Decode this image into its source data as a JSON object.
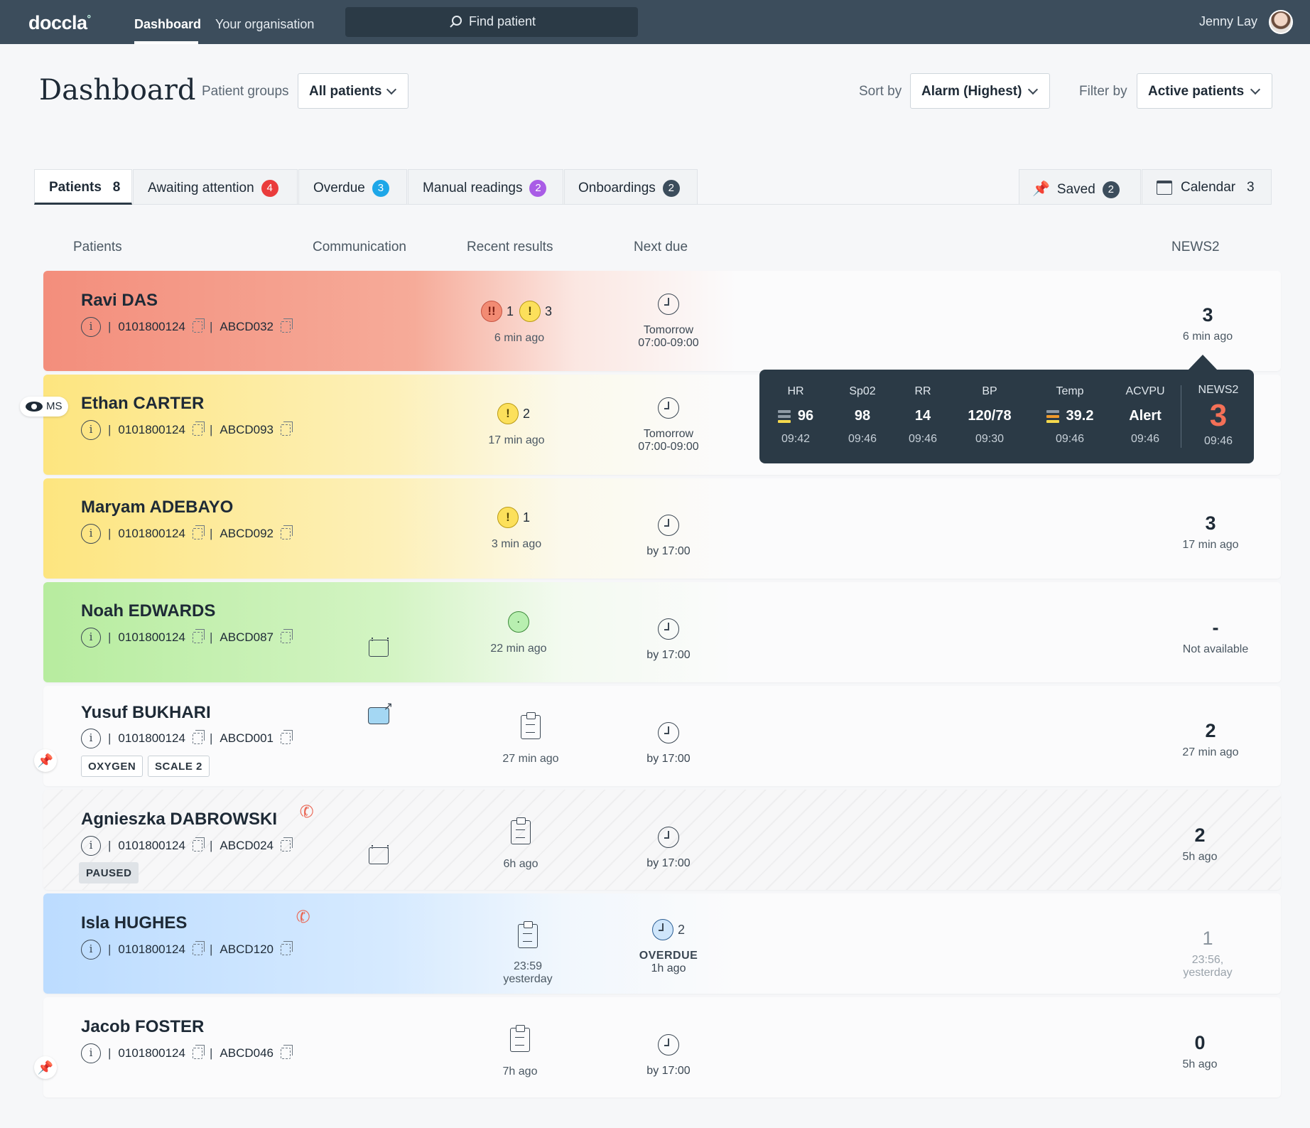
{
  "nav": {
    "logo": "doccla",
    "links": [
      "Dashboard",
      "Your organisation"
    ],
    "search_placeholder": "Find patient",
    "user": "Jenny Lay"
  },
  "header": {
    "title": "Dashboard",
    "patient_groups_label": "Patient groups",
    "patient_groups_value": "All patients",
    "sort_label": "Sort by",
    "sort_value": "Alarm (Highest)",
    "filter_label": "Filter by",
    "filter_value": "Active patients"
  },
  "tabs": [
    {
      "label": "Patients",
      "count": "8"
    },
    {
      "label": "Awaiting attention",
      "count": "4"
    },
    {
      "label": "Overdue",
      "count": "3"
    },
    {
      "label": "Manual readings",
      "count": "2"
    },
    {
      "label": "Onboardings",
      "count": "2"
    },
    {
      "label": "Saved",
      "count": "2"
    },
    {
      "label": "Calendar",
      "count": "3"
    }
  ],
  "columns": [
    "Patients",
    "Communication",
    "Recent results",
    "Next due",
    "NEWS2"
  ],
  "watch_badge": "MS",
  "patients": [
    {
      "name": "Ravi DAS",
      "nhs": "0101800124",
      "code": "ABCD032",
      "alerts": [
        "1",
        "3"
      ],
      "result_time": "6 min ago",
      "due_line1": "Tomorrow",
      "due_line2": "07:00-09:00",
      "news": "3",
      "news_time": "6 min ago"
    },
    {
      "name": "Ethan CARTER",
      "nhs": "0101800124",
      "code": "ABCD093",
      "alerts": [
        "2"
      ],
      "result_time": "17 min ago",
      "due_line1": "Tomorrow",
      "due_line2": "07:00-09:00"
    },
    {
      "name": "Maryam ADEBAYO",
      "nhs": "0101800124",
      "code": "ABCD092",
      "alerts": [
        "1"
      ],
      "result_time": "3 min ago",
      "due_line1": "by 17:00",
      "news": "3",
      "news_time": "17 min ago"
    },
    {
      "name": "Noah EDWARDS",
      "nhs": "0101800124",
      "code": "ABCD087",
      "result_time": "22 min ago",
      "due_line1": "by 17:00",
      "news": "-",
      "news_time": "Not available"
    },
    {
      "name": "Yusuf BUKHARI",
      "nhs": "0101800124",
      "code": "ABCD001",
      "tags": [
        "OXYGEN",
        "SCALE 2"
      ],
      "result_time": "27 min ago",
      "due_line1": "by 17:00",
      "news": "2",
      "news_time": "27 min ago"
    },
    {
      "name": "Agnieszka DABROWSKI",
      "nhs": "0101800124",
      "code": "ABCD024",
      "tags": [
        "PAUSED"
      ],
      "result_time": "6h ago",
      "due_line1": "by 17:00",
      "news": "2",
      "news_time": "5h ago"
    },
    {
      "name": "Isla HUGHES",
      "nhs": "0101800124",
      "code": "ABCD120",
      "result_time_line1": "23:59",
      "result_time_line2": "yesterday",
      "due_count": "2",
      "due_line1": "OVERDUE",
      "due_line2": "1h ago",
      "news": "1",
      "news_time_line1": "23:56,",
      "news_time_line2": "yesterday"
    },
    {
      "name": "Jacob FOSTER",
      "nhs": "0101800124",
      "code": "ABCD046",
      "result_time": "7h ago",
      "due_line1": "by 17:00",
      "news": "0",
      "news_time": "5h ago"
    }
  ],
  "vitals_popup": {
    "items": [
      {
        "label": "HR",
        "value": "96",
        "time": "09:42"
      },
      {
        "label": "Sp02",
        "value": "98",
        "time": "09:46"
      },
      {
        "label": "RR",
        "value": "14",
        "time": "09:46"
      },
      {
        "label": "BP",
        "value": "120/78",
        "time": "09:30"
      },
      {
        "label": "Temp",
        "value": "39.2",
        "time": "09:46"
      },
      {
        "label": "ACVPU",
        "value": "Alert",
        "time": "09:46"
      }
    ],
    "news_label": "NEWS2",
    "news_value": "3",
    "news_time": "09:46"
  },
  "colors": {
    "nav": "#3c4d5c",
    "alarm": "#f38e7c",
    "warn": "#fde57f",
    "ok": "#b7ec9f",
    "info": "#bcdcff",
    "news_alert": "#f47057"
  }
}
